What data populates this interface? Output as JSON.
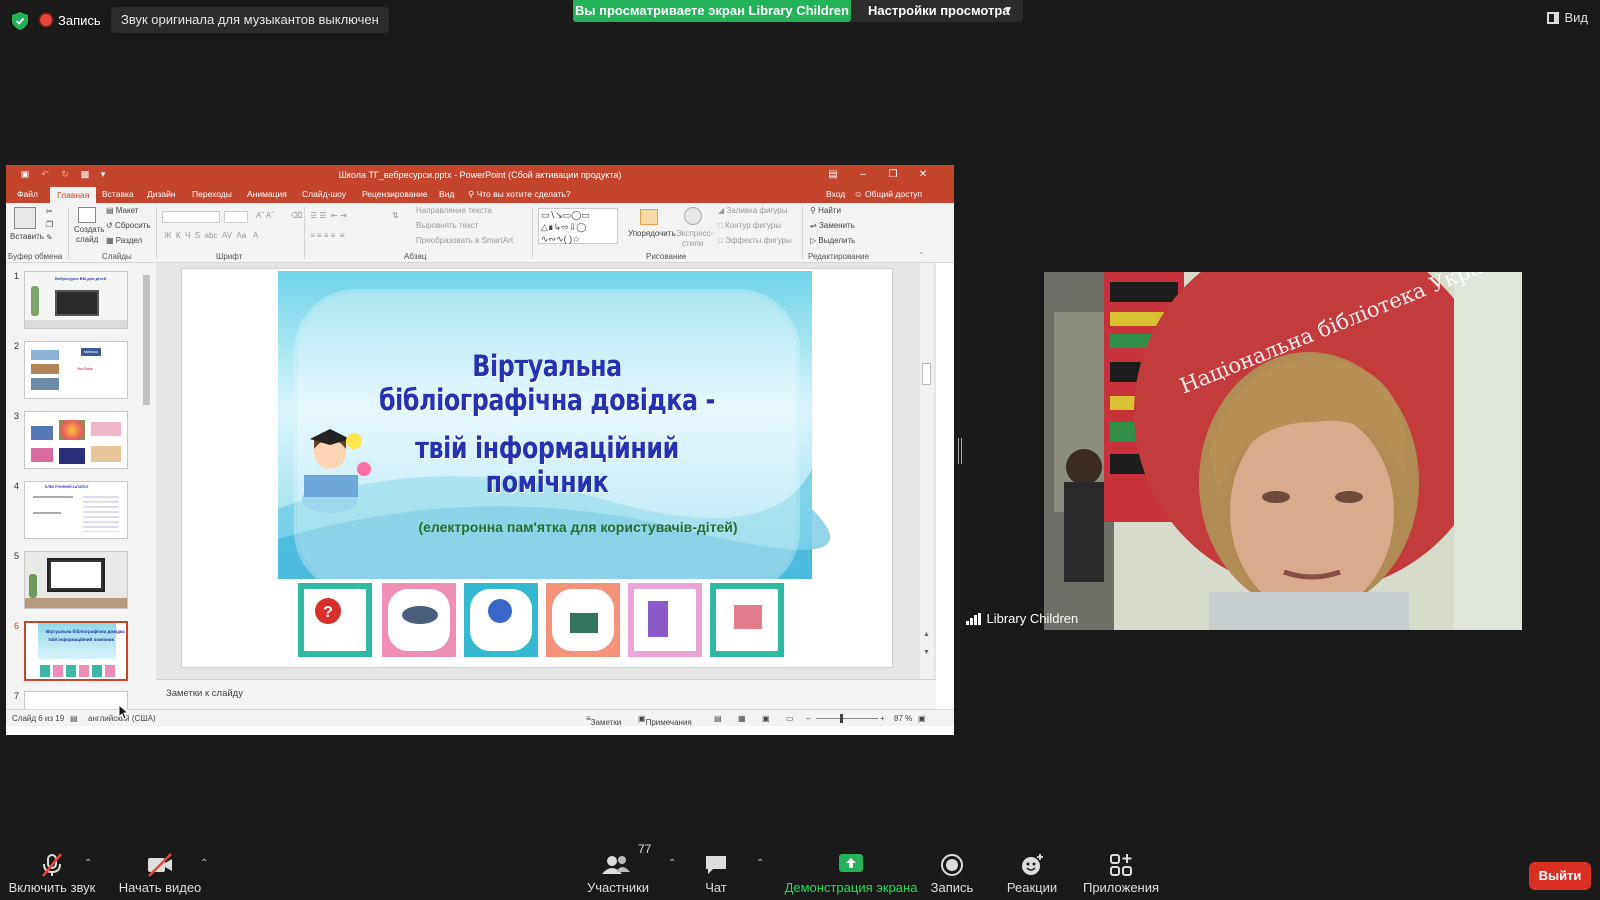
{
  "zoom": {
    "recording_label": "Запись",
    "notice": "Звук оригинала для музыкантов выключен",
    "share_banner": "Вы просматриваете экран Library Children",
    "view_settings": "Настройки просмотра",
    "view_label": "Вид"
  },
  "ppt": {
    "window_title": "Школа ТГ_вебресурси.pptx - PowerPoint (Сбой активации продукта)",
    "tabs": [
      "Файл",
      "Главная",
      "Вставка",
      "Дизайн",
      "Переходы",
      "Анимация",
      "Слайд-шоу",
      "Рецензирование",
      "Вид"
    ],
    "tell_me": "Что вы хотите сделать?",
    "signin": "Вход",
    "share": "Общий доступ",
    "ribbon": {
      "paste": "Вставить",
      "create_slide_1": "Создать",
      "create_slide_2": "слайд",
      "layout": "Макет",
      "reset": "Сбросить",
      "section": "Раздел",
      "text_direction": "Направление текста",
      "align_text": "Выровнять текст",
      "convert_smartart": "Преобразовать в SmartArt",
      "arrange": "Упорядочить",
      "quick_styles_1": "Экспресс-",
      "quick_styles_2": "стили",
      "shape_fill": "Заливка фигуры",
      "shape_outline": "Контур фигуры",
      "shape_effects": "Эффекты фигуры",
      "find": "Найти",
      "replace": "Заменить",
      "select": "Выделить",
      "groups": {
        "clipboard": "Буфер обмена",
        "slides": "Слайды",
        "font": "Шрифт",
        "paragraph": "Абзац",
        "drawing": "Рисование",
        "editing": "Редактирование"
      }
    },
    "thumbnails": [
      "1",
      "2",
      "3",
      "4",
      "5",
      "6",
      "7"
    ],
    "slide": {
      "title_line1": "Віртуальна бібліографічна довідка -",
      "title_line2": "твій інформаційний помічник",
      "subtitle": "(електронна пам'ятка для користувачів-дітей)"
    },
    "thumb1_title": "Вебресурси ВМ для дітей",
    "thumb2_fb": "facebook",
    "thumb2_yt": "YouTube",
    "thumb4_title": "ЕЛЕКТРОННИЙ КАТАЛОГ",
    "thumb6_line1": "Віртуальна бібліографічна довідка",
    "thumb6_line2": "твій інформаційний помічник",
    "notes_placeholder": "Заметки к слайду",
    "status": {
      "slide_counter": "Слайд 6 из 19",
      "language": "английский (США)",
      "notes_btn": "Заметки",
      "comments_btn": "Примечания",
      "zoom": "87 %"
    }
  },
  "video": {
    "participant_name": "Library Children",
    "banner_text": "Національна бібліотека України"
  },
  "toolbar": {
    "unmute": "Включить звук",
    "start_video": "Начать видео",
    "participants": "Участники",
    "participants_count": "77",
    "chat": "Чат",
    "share_screen": "Демонстрация экрана",
    "record": "Запись",
    "reactions": "Реакции",
    "apps": "Приложения",
    "leave": "Выйти"
  },
  "colors": {
    "share_green": "#23b257",
    "ppt_accent": "#c5442d",
    "leave_red": "#d93025"
  }
}
